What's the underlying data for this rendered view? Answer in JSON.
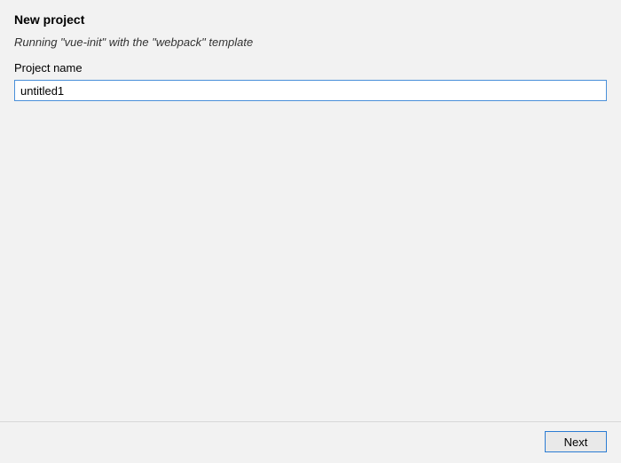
{
  "header": {
    "title": "New project",
    "subtitle": "Running \"vue-init\" with the \"webpack\" template"
  },
  "form": {
    "project_name_label": "Project name",
    "project_name_value": "untitled1"
  },
  "footer": {
    "next_label": "Next"
  }
}
